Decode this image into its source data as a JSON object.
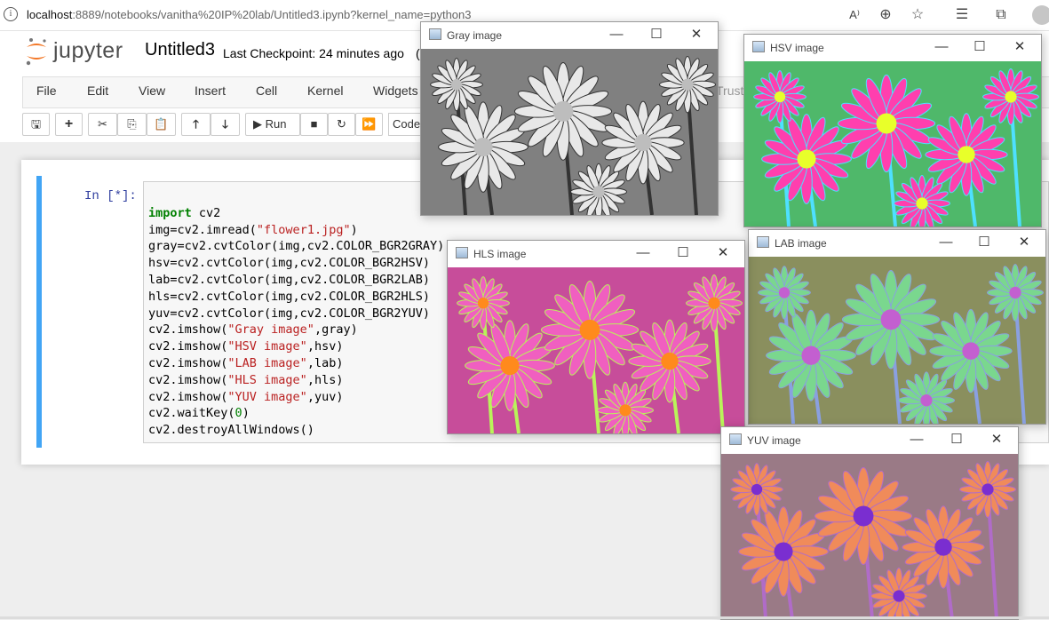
{
  "browser": {
    "url_host": "localhost",
    "url_rest": ":8889/notebooks/vanitha%20IP%20lab/Untitled3.ipynb?kernel_name=python3"
  },
  "jupyter": {
    "logo_text": "jupyter",
    "notebook_title": "Untitled3",
    "checkpoint": "Last Checkpoint: 24 minutes ago",
    "checkpoint_tail": "(",
    "trusted": "Trust",
    "menu": [
      "File",
      "Edit",
      "View",
      "Insert",
      "Cell",
      "Kernel",
      "Widgets"
    ],
    "toolbar": {
      "run": "Run",
      "cell_type": "Code"
    }
  },
  "cell": {
    "prompt": "In [*]:",
    "code": [
      "import cv2",
      "img=cv2.imread(\"flower1.jpg\")",
      "gray=cv2.cvtColor(img,cv2.COLOR_BGR2GRAY)",
      "hsv=cv2.cvtColor(img,cv2.COLOR_BGR2HSV)",
      "lab=cv2.cvtColor(img,cv2.COLOR_BGR2LAB)",
      "hls=cv2.cvtColor(img,cv2.COLOR_BGR2HLS)",
      "yuv=cv2.cvtColor(img,cv2.COLOR_BGR2YUV)",
      "cv2.imshow(\"Gray image\",gray)",
      "cv2.imshow(\"HSV image\",hsv)",
      "cv2.imshow(\"LAB image\",lab)",
      "cv2.imshow(\"HLS image\",hls)",
      "cv2.imshow(\"YUV image\",yuv)",
      "cv2.waitKey(0)",
      "cv2.destroyAllWindows()"
    ]
  },
  "windows": {
    "gray": {
      "title": "Gray image",
      "bg": "#808080",
      "petal": "#e8e8e8",
      "center": "#bdbdbd",
      "accent": "#333333"
    },
    "hsv": {
      "title": "HSV image",
      "bg": "#4fb86a",
      "petal": "#ff3fae",
      "center": "#e8ff2a",
      "accent": "#4ee0ff"
    },
    "hls": {
      "title": "HLS image",
      "bg": "#c74d9a",
      "petal": "#f05fc0",
      "center": "#ff8a1c",
      "accent": "#b9f35a"
    },
    "lab": {
      "title": "LAB image",
      "bg": "#8a8f5e",
      "petal": "#7ad78e",
      "center": "#c35fd0",
      "accent": "#8aa0e0"
    },
    "yuv": {
      "title": "YUV image",
      "bg": "#9a7a86",
      "petal": "#f08b5a",
      "center": "#7a2ed0",
      "accent": "#b06cc8"
    }
  }
}
